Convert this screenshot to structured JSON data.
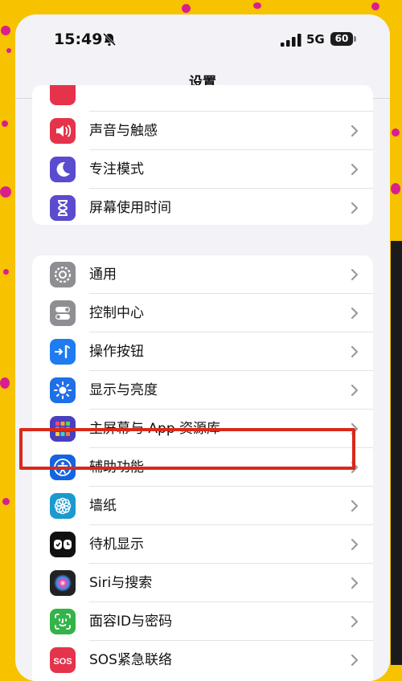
{
  "status_bar": {
    "time": "15:49",
    "network": "5G",
    "battery": "60"
  },
  "nav": {
    "title": "设置"
  },
  "group1": {
    "items": [
      {
        "label": "",
        "icon": "notifications-icon",
        "color": "#e5334b"
      },
      {
        "label": "声音与触感",
        "icon": "speaker-icon",
        "color": "#e5334b"
      },
      {
        "label": "专注模式",
        "icon": "moon-icon",
        "color": "#5a4bcf"
      },
      {
        "label": "屏幕使用时间",
        "icon": "hourglass-icon",
        "color": "#5a4bcf"
      }
    ]
  },
  "group2": {
    "items": [
      {
        "label": "通用",
        "icon": "gear-icon",
        "color": "#8e8e93"
      },
      {
        "label": "控制中心",
        "icon": "toggles-icon",
        "color": "#8e8e93"
      },
      {
        "label": "操作按钮",
        "icon": "action-button-icon",
        "color": "#1e7cf0"
      },
      {
        "label": "显示与亮度",
        "icon": "sun-icon",
        "color": "#1e6fe8"
      },
      {
        "label": "主屏幕与 App 资源库",
        "icon": "app-grid-icon",
        "color": "#4a3fbf"
      },
      {
        "label": "辅助功能",
        "icon": "accessibility-icon",
        "color": "#1463e0"
      },
      {
        "label": "墙纸",
        "icon": "flower-icon",
        "color": "#1a9ad0"
      },
      {
        "label": "待机显示",
        "icon": "standby-icon",
        "color": "#111111"
      },
      {
        "label": "Siri与搜索",
        "icon": "siri-icon",
        "color": "#222222"
      },
      {
        "label": "面容ID与密码",
        "icon": "face-id-icon",
        "color": "#33b34a"
      },
      {
        "label": "SOS紧急联络",
        "icon": "sos-icon",
        "color": "#e5334b"
      }
    ]
  },
  "highlight_color": "#d8291a"
}
